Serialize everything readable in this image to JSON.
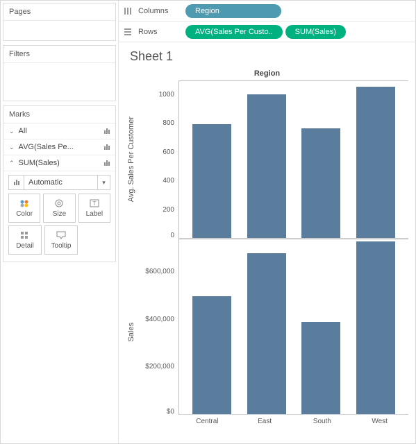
{
  "panels": {
    "pages": "Pages",
    "filters": "Filters",
    "marks": "Marks"
  },
  "marks": {
    "rows": [
      {
        "label": "All",
        "expanded": false
      },
      {
        "label": "AVG(Sales Pe...",
        "expanded": false
      },
      {
        "label": "SUM(Sales)",
        "expanded": true
      }
    ],
    "type": "Automatic",
    "cards": {
      "color": "Color",
      "size": "Size",
      "label": "Label",
      "detail": "Detail",
      "tooltip": "Tooltip"
    }
  },
  "shelves": {
    "columns_label": "Columns",
    "rows_label": "Rows",
    "columns": [
      "Region"
    ],
    "rows": [
      "AVG(Sales Per Custo..",
      "SUM(Sales)"
    ]
  },
  "sheet": {
    "title": "Sheet 1",
    "column_header": "Region"
  },
  "chart_data": [
    {
      "type": "bar",
      "title": "",
      "xlabel": "Region",
      "ylabel": "Avg. Sales Per Customer",
      "categories": [
        "Central",
        "East",
        "South",
        "West"
      ],
      "values": [
        800,
        1010,
        770,
        1060
      ],
      "ylim": [
        0,
        1100
      ],
      "ticks": [
        1000,
        800,
        600,
        400,
        200,
        0
      ]
    },
    {
      "type": "bar",
      "title": "",
      "xlabel": "Region",
      "ylabel": "Sales",
      "categories": [
        "Central",
        "East",
        "South",
        "West"
      ],
      "values": [
        500000,
        680000,
        390000,
        730000
      ],
      "ylim": [
        0,
        740000
      ],
      "ticks": [
        "$600,000",
        "$400,000",
        "$200,000",
        "$0"
      ],
      "tick_values": [
        600000,
        400000,
        200000,
        0
      ]
    }
  ]
}
